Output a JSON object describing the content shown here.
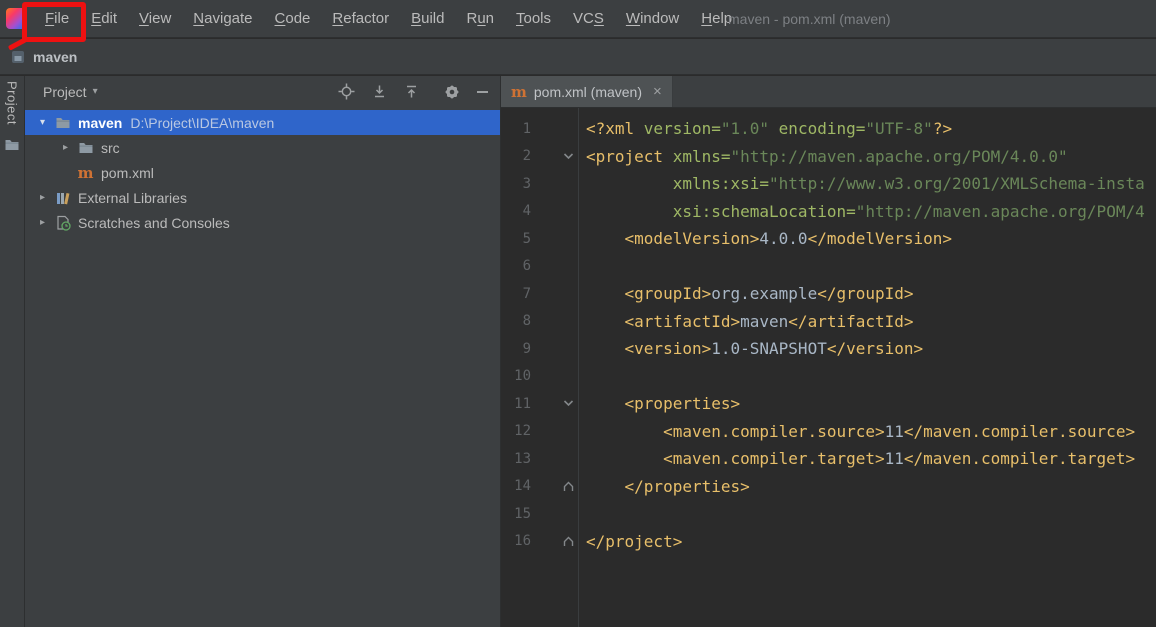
{
  "colors": {
    "selection_blue": "#2f65ca",
    "annotation_red": "#ee1111",
    "xml_tag": "#e8bf6a",
    "xml_attribute": "#9fb865",
    "xml_string": "#6a8759",
    "xml_text": "#a9b7c6",
    "panel_bg": "#3c3f41",
    "editor_bg": "#2b2b2b"
  },
  "icons": {
    "chevron-down": "▾",
    "chevron-right": "▸",
    "close": "×"
  },
  "menubar": {
    "items": [
      {
        "label": "File",
        "u": 0
      },
      {
        "label": "Edit",
        "u": 0
      },
      {
        "label": "View",
        "u": 0
      },
      {
        "label": "Navigate",
        "u": 0
      },
      {
        "label": "Code",
        "u": 0
      },
      {
        "label": "Refactor",
        "u": 0
      },
      {
        "label": "Build",
        "u": 0
      },
      {
        "label": "Run",
        "u": 1
      },
      {
        "label": "Tools",
        "u": 0
      },
      {
        "label": "VCS",
        "u": 2
      },
      {
        "label": "Window",
        "u": 0
      },
      {
        "label": "Help",
        "u": 0
      }
    ],
    "window_title": "maven - pom.xml (maven)"
  },
  "navbar": {
    "project": "maven"
  },
  "left_stripe": {
    "label": "Project"
  },
  "project": {
    "header": {
      "title": "Project"
    },
    "tree": [
      {
        "name": "maven",
        "suffix": "D:\\Project\\IDEA\\maven",
        "icon": "folder",
        "chevron": "down",
        "level": 0,
        "selected": true,
        "bold": true
      },
      {
        "name": "src",
        "icon": "folder",
        "chevron": "right",
        "level": 1
      },
      {
        "name": "pom.xml",
        "icon": "maven",
        "chevron": "none",
        "level": 1
      },
      {
        "name": "External Libraries",
        "icon": "library",
        "chevron": "right",
        "level": 0
      },
      {
        "name": "Scratches and Consoles",
        "icon": "scratch",
        "chevron": "right",
        "level": 0
      }
    ]
  },
  "editor": {
    "tabs": [
      {
        "label": "pom.xml (maven)",
        "active": true
      }
    ],
    "lines": [
      {
        "n": "1",
        "fold": "",
        "tk": [
          [
            "tag",
            "<?xml "
          ],
          [
            "attr",
            "version="
          ],
          [
            "str",
            "\"1.0\""
          ],
          [
            "plain",
            " "
          ],
          [
            "attr",
            "encoding="
          ],
          [
            "str",
            "\"UTF-8\""
          ],
          [
            "tag",
            "?>"
          ]
        ]
      },
      {
        "n": "2",
        "fold": "open",
        "tk": [
          [
            "tag",
            "<project "
          ],
          [
            "attr",
            "xmlns="
          ],
          [
            "str",
            "\"http://maven.apache.org/POM/4.0.0\""
          ]
        ]
      },
      {
        "n": "3",
        "fold": "",
        "tk": [
          [
            "plain",
            "         "
          ],
          [
            "attr",
            "xmlns:xsi="
          ],
          [
            "str",
            "\"http://www.w3.org/2001/XMLSchema-insta"
          ]
        ]
      },
      {
        "n": "4",
        "fold": "",
        "tk": [
          [
            "plain",
            "         "
          ],
          [
            "attr",
            "xsi:schemaLocation="
          ],
          [
            "str",
            "\"http://maven.apache.org/POM/4"
          ]
        ]
      },
      {
        "n": "5",
        "fold": "",
        "tk": [
          [
            "plain",
            "    "
          ],
          [
            "tag",
            "<modelVersion>"
          ],
          [
            "text",
            "4.0.0"
          ],
          [
            "tag",
            "</modelVersion>"
          ]
        ]
      },
      {
        "n": "6",
        "fold": "",
        "tk": []
      },
      {
        "n": "7",
        "fold": "",
        "tk": [
          [
            "plain",
            "    "
          ],
          [
            "tag",
            "<groupId>"
          ],
          [
            "text",
            "org.example"
          ],
          [
            "tag",
            "</groupId>"
          ]
        ]
      },
      {
        "n": "8",
        "fold": "",
        "tk": [
          [
            "plain",
            "    "
          ],
          [
            "tag",
            "<artifactId>"
          ],
          [
            "text",
            "maven"
          ],
          [
            "tag",
            "</artifactId>"
          ]
        ]
      },
      {
        "n": "9",
        "fold": "",
        "tk": [
          [
            "plain",
            "    "
          ],
          [
            "tag",
            "<version>"
          ],
          [
            "text",
            "1.0-SNAPSHOT"
          ],
          [
            "tag",
            "</version>"
          ]
        ]
      },
      {
        "n": "10",
        "fold": "",
        "tk": []
      },
      {
        "n": "11",
        "fold": "open",
        "tk": [
          [
            "plain",
            "    "
          ],
          [
            "tag",
            "<properties>"
          ]
        ]
      },
      {
        "n": "12",
        "fold": "",
        "tk": [
          [
            "plain",
            "        "
          ],
          [
            "tag",
            "<maven.compiler.source>"
          ],
          [
            "text",
            "11"
          ],
          [
            "tag",
            "</maven.compiler.source>"
          ]
        ]
      },
      {
        "n": "13",
        "fold": "",
        "tk": [
          [
            "plain",
            "        "
          ],
          [
            "tag",
            "<maven.compiler.target>"
          ],
          [
            "text",
            "11"
          ],
          [
            "tag",
            "</maven.compiler.target>"
          ]
        ]
      },
      {
        "n": "14",
        "fold": "end",
        "tk": [
          [
            "plain",
            "    "
          ],
          [
            "tag",
            "</properties>"
          ]
        ]
      },
      {
        "n": "15",
        "fold": "",
        "tk": []
      },
      {
        "n": "16",
        "fold": "end",
        "tk": [
          [
            "tag",
            "</project>"
          ]
        ]
      }
    ]
  }
}
